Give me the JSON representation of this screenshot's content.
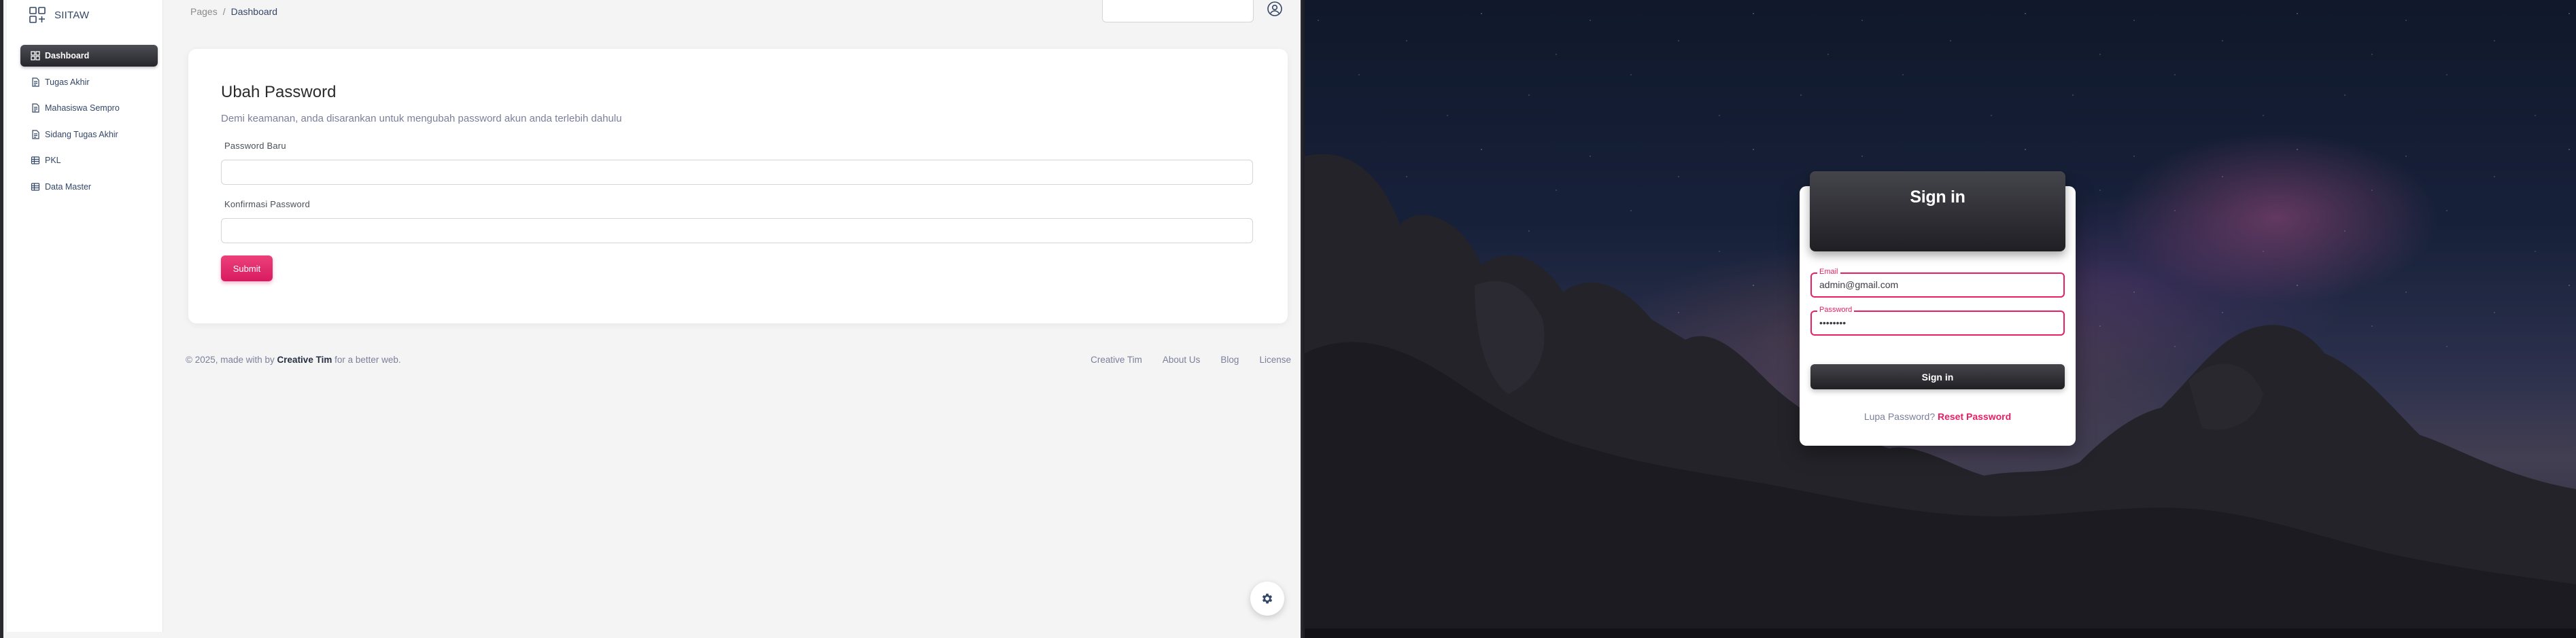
{
  "dashboard": {
    "brand": "SIITAW",
    "nav": [
      {
        "label": "Dashboard",
        "icon": "dashboard-icon",
        "active": true
      },
      {
        "label": "Tugas Akhir",
        "icon": "document-icon",
        "active": false
      },
      {
        "label": "Mahasiswa Sempro",
        "icon": "document-icon",
        "active": false
      },
      {
        "label": "Sidang Tugas Akhir",
        "icon": "document-icon",
        "active": false
      },
      {
        "label": "PKL",
        "icon": "table-icon",
        "active": false
      },
      {
        "label": "Data Master",
        "icon": "table-icon",
        "active": false
      }
    ],
    "breadcrumb": {
      "root": "Pages",
      "separator": "/",
      "current": "Dashboard"
    },
    "card": {
      "title": "Ubah Password",
      "description": "Demi keamanan, anda disarankan untuk mengubah password akun anda terlebih dahulu",
      "new_password_label": "Password Baru",
      "confirm_password_label": "Konfirmasi Password",
      "submit_label": "Submit"
    },
    "footer": {
      "copyright_prefix": "© 2025, made with by",
      "brand": "Creative Tim",
      "copyright_suffix": "for a better web.",
      "links": [
        "Creative Tim",
        "About Us",
        "Blog",
        "License"
      ]
    }
  },
  "login": {
    "title": "Sign in",
    "email_label": "Email",
    "email_value": "admin@gmail.com",
    "password_label": "Password",
    "password_value": "••••••••",
    "signin_label": "Sign in",
    "forgot_prefix": "Lupa Password?",
    "forgot_link": "Reset Password"
  },
  "colors": {
    "accent": "#e91e63",
    "dark": "#2b2b30"
  }
}
